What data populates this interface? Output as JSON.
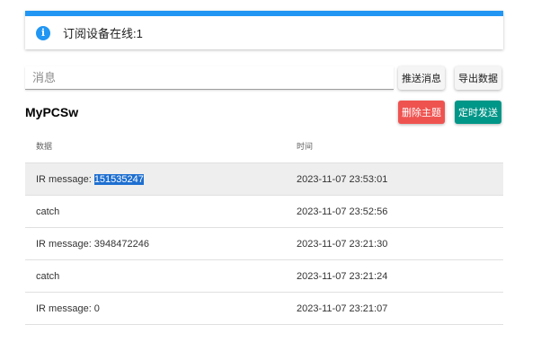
{
  "alert": {
    "icon": "info-icon",
    "text": "订阅设备在线:1",
    "accent_color": "#2196f3"
  },
  "message_input": {
    "placeholder": "消息",
    "value": ""
  },
  "buttons": {
    "send": "推送消息",
    "export": "导出数据",
    "delete_topic": "删除主题",
    "timer_send": "定时发送"
  },
  "colors": {
    "delete_button": "#ef5350",
    "timer_button": "#009688"
  },
  "topic": {
    "name": "MyPCSw"
  },
  "table": {
    "headers": {
      "data": "数据",
      "time": "时间"
    },
    "rows": [
      {
        "data_prefix": "IR message: ",
        "data_highlight": "151535247",
        "time": "2023-11-07 23:53:01",
        "selected": true
      },
      {
        "data_prefix": "catch",
        "data_highlight": "",
        "time": "2023-11-07 23:52:56",
        "selected": false
      },
      {
        "data_prefix": "IR message: 3948472246",
        "data_highlight": "",
        "time": "2023-11-07 23:21:30",
        "selected": false
      },
      {
        "data_prefix": "catch",
        "data_highlight": "",
        "time": "2023-11-07 23:21:24",
        "selected": false
      },
      {
        "data_prefix": "IR message: 0",
        "data_highlight": "",
        "time": "2023-11-07 23:21:07",
        "selected": false
      }
    ]
  }
}
